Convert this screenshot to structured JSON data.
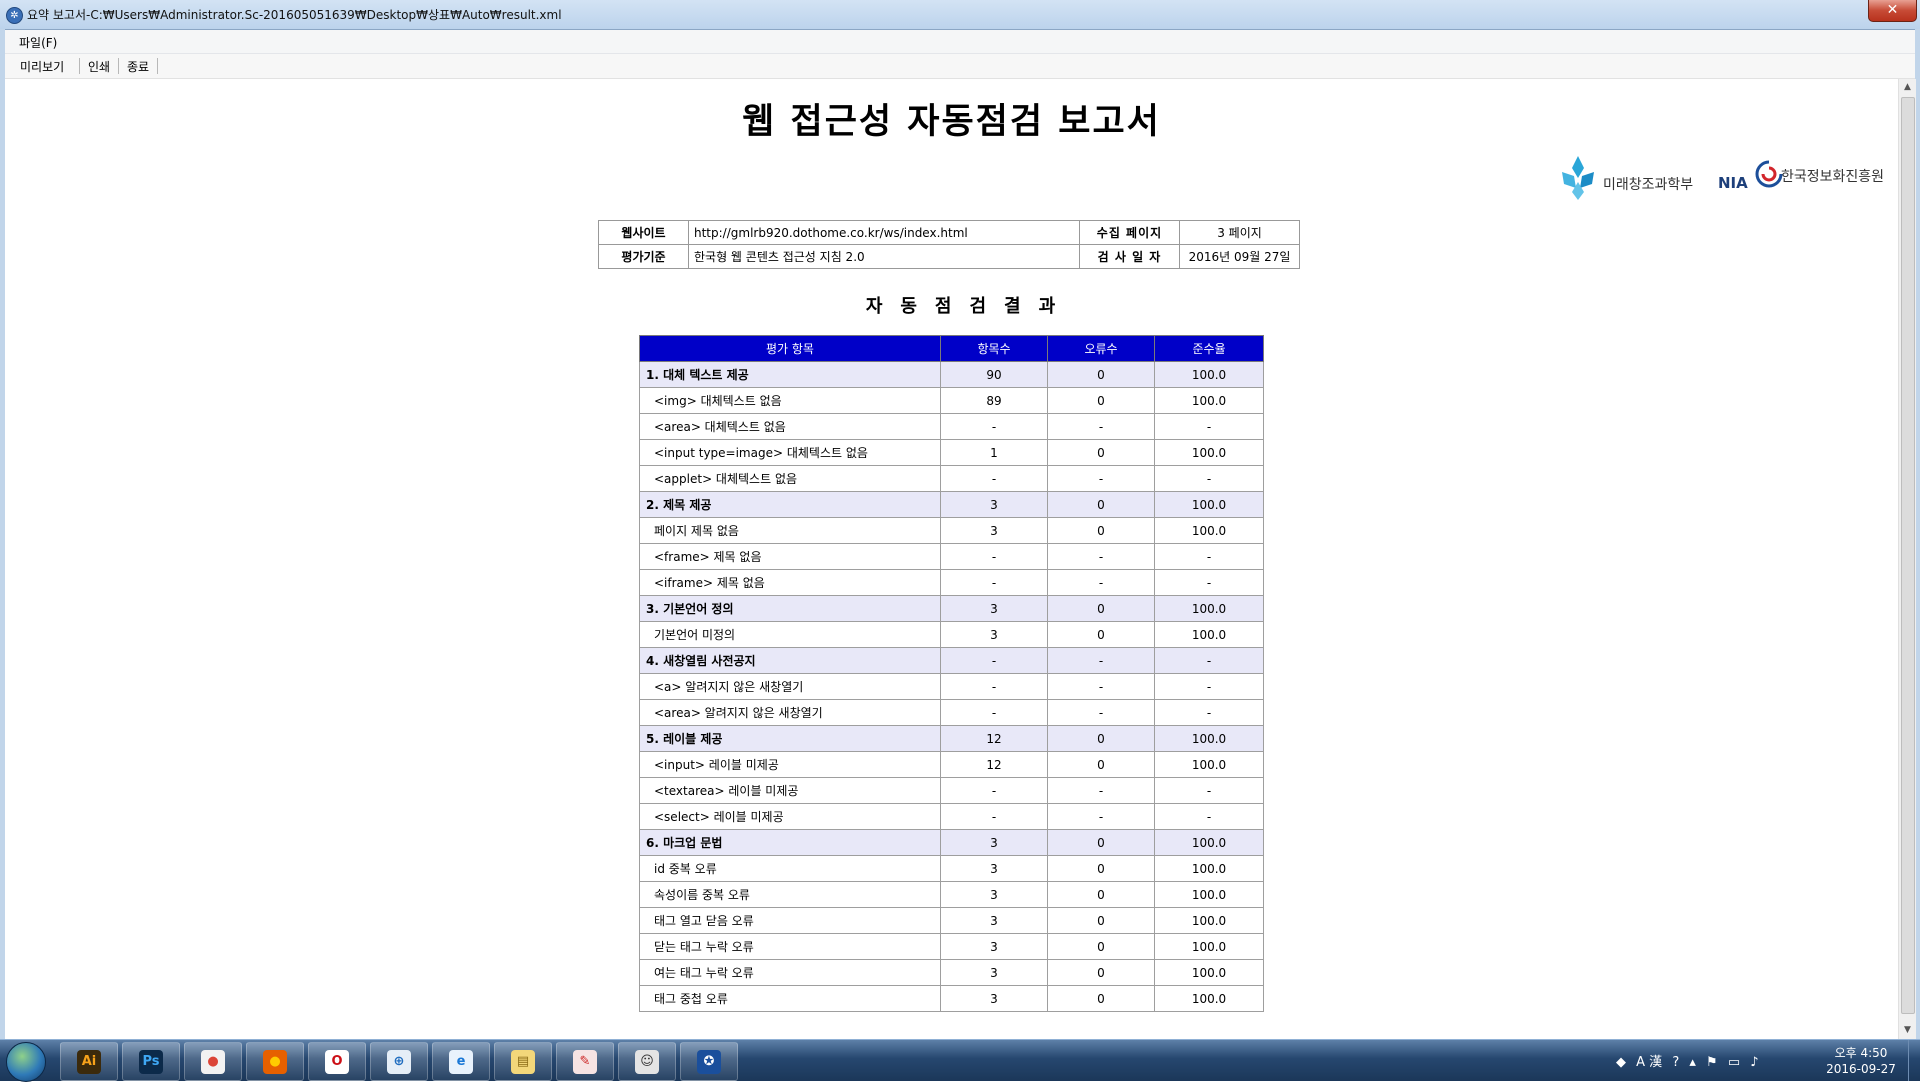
{
  "window": {
    "title": "요약 보고서-C:₩Users₩Administrator.Sc-201605051639₩Desktop₩상표₩Auto₩result.xml",
    "close_glyph": "✕"
  },
  "menu": {
    "file": "파일(F)"
  },
  "toolbar": {
    "preview": "미리보기",
    "print": "인쇄",
    "exit": "종료"
  },
  "report": {
    "title": "웹 접근성 자동점검 보고서",
    "logos": {
      "msip": "미래창조과학부",
      "nia_abbr": "NIA",
      "nia_name": "한국정보화진흥원"
    },
    "info": {
      "website_label": "웹사이트",
      "website_value": "http://gmlrb920.dothome.co.kr/ws/index.html",
      "pages_label": "수집 페이지",
      "pages_value": "3 페이지",
      "standard_label": "평가기준",
      "standard_value": "한국형 웹 콘텐츠 접근성 지침 2.0",
      "date_label": "검 사 일 자",
      "date_value": "2016년 09월 27일"
    },
    "result_heading": "자동점검결과",
    "columns": [
      "평가 항목",
      "항목수",
      "오류수",
      "준수율"
    ],
    "rows": [
      {
        "type": "cat",
        "name": "1. 대체 텍스트 제공",
        "count": "90",
        "errors": "0",
        "rate": "100.0"
      },
      {
        "type": "sub",
        "name": "<img> 대체텍스트 없음",
        "count": "89",
        "errors": "0",
        "rate": "100.0"
      },
      {
        "type": "sub",
        "name": "<area> 대체텍스트 없음",
        "count": "-",
        "errors": "-",
        "rate": "-"
      },
      {
        "type": "sub",
        "name": "<input type=image> 대체텍스트 없음",
        "count": "1",
        "errors": "0",
        "rate": "100.0"
      },
      {
        "type": "sub",
        "name": "<applet> 대체텍스트 없음",
        "count": "-",
        "errors": "-",
        "rate": "-"
      },
      {
        "type": "cat",
        "name": "2. 제목 제공",
        "count": "3",
        "errors": "0",
        "rate": "100.0"
      },
      {
        "type": "sub",
        "name": "페이지 제목 없음",
        "count": "3",
        "errors": "0",
        "rate": "100.0"
      },
      {
        "type": "sub",
        "name": "<frame> 제목 없음",
        "count": "-",
        "errors": "-",
        "rate": "-"
      },
      {
        "type": "sub",
        "name": "<iframe> 제목 없음",
        "count": "-",
        "errors": "-",
        "rate": "-"
      },
      {
        "type": "cat",
        "name": "3. 기본언어 정의",
        "count": "3",
        "errors": "0",
        "rate": "100.0"
      },
      {
        "type": "sub",
        "name": "기본언어 미정의",
        "count": "3",
        "errors": "0",
        "rate": "100.0"
      },
      {
        "type": "cat",
        "name": "4. 새창열림 사전공지",
        "count": "-",
        "errors": "-",
        "rate": "-"
      },
      {
        "type": "sub",
        "name": "<a> 알려지지 않은 새창열기",
        "count": "-",
        "errors": "-",
        "rate": "-"
      },
      {
        "type": "sub",
        "name": "<area> 알려지지 않은 새창열기",
        "count": "-",
        "errors": "-",
        "rate": "-"
      },
      {
        "type": "cat",
        "name": "5. 레이블 제공",
        "count": "12",
        "errors": "0",
        "rate": "100.0"
      },
      {
        "type": "sub",
        "name": "<input> 레이블 미제공",
        "count": "12",
        "errors": "0",
        "rate": "100.0"
      },
      {
        "type": "sub",
        "name": "<textarea> 레이블 미제공",
        "count": "-",
        "errors": "-",
        "rate": "-"
      },
      {
        "type": "sub",
        "name": "<select> 레이블 미제공",
        "count": "-",
        "errors": "-",
        "rate": "-"
      },
      {
        "type": "cat",
        "name": "6. 마크업 문법",
        "count": "3",
        "errors": "0",
        "rate": "100.0"
      },
      {
        "type": "sub",
        "name": "id 중복 오류",
        "count": "3",
        "errors": "0",
        "rate": "100.0"
      },
      {
        "type": "sub",
        "name": "속성이름 중복 오류",
        "count": "3",
        "errors": "0",
        "rate": "100.0"
      },
      {
        "type": "sub",
        "name": "태그 열고 닫음 오류",
        "count": "3",
        "errors": "0",
        "rate": "100.0"
      },
      {
        "type": "sub",
        "name": "닫는 태그 누락 오류",
        "count": "3",
        "errors": "0",
        "rate": "100.0"
      },
      {
        "type": "sub",
        "name": "여는 태그 누락 오류",
        "count": "3",
        "errors": "0",
        "rate": "100.0"
      },
      {
        "type": "sub",
        "name": "태그 중첩 오류",
        "count": "3",
        "errors": "0",
        "rate": "100.0"
      }
    ]
  },
  "taskbar": {
    "apps": [
      {
        "name": "illustrator-icon",
        "glyph": "Ai",
        "bg": "#3b2a0c",
        "fg": "#f7a21a"
      },
      {
        "name": "photoshop-icon",
        "glyph": "Ps",
        "bg": "#0c2a4a",
        "fg": "#3fa8f5"
      },
      {
        "name": "chrome-icon",
        "glyph": "●",
        "bg": "#f2f2f2",
        "fg": "#db4437"
      },
      {
        "name": "firefox-icon",
        "glyph": "●",
        "bg": "#e66000",
        "fg": "#ffcb00"
      },
      {
        "name": "opera-icon",
        "glyph": "O",
        "bg": "#ffffff",
        "fg": "#cc0f16"
      },
      {
        "name": "safari-icon",
        "glyph": "⊕",
        "bg": "#e5eef7",
        "fg": "#1e6cbf"
      },
      {
        "name": "internet-explorer-icon",
        "glyph": "e",
        "bg": "#e8f2fc",
        "fg": "#1a78d6"
      },
      {
        "name": "file-explorer-icon",
        "glyph": "▤",
        "bg": "#f3d77a",
        "fg": "#8a6a14"
      },
      {
        "name": "paint-icon",
        "glyph": "✎",
        "bg": "#f6e3e3",
        "fg": "#c22"
      },
      {
        "name": "printer-app-icon",
        "glyph": "☺",
        "bg": "#e4e4e4",
        "fg": "#333"
      },
      {
        "name": "accessibility-checker-icon",
        "glyph": "✪",
        "bg": "#1a4f9c",
        "fg": "#ffffff"
      }
    ],
    "tray": {
      "ime": "A 漢",
      "time": "오후 4:50",
      "date": "2016-09-27"
    }
  }
}
